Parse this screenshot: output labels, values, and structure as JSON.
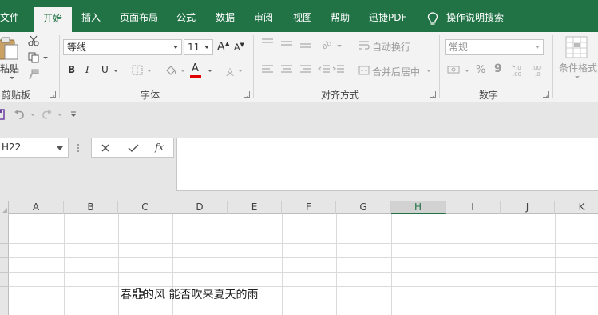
{
  "tabs": [
    {
      "label": "文件",
      "active": false
    },
    {
      "label": "开始",
      "active": true
    },
    {
      "label": "插入",
      "active": false
    },
    {
      "label": "页面布局",
      "active": false
    },
    {
      "label": "公式",
      "active": false
    },
    {
      "label": "数据",
      "active": false
    },
    {
      "label": "审阅",
      "active": false
    },
    {
      "label": "视图",
      "active": false
    },
    {
      "label": "帮助",
      "active": false
    },
    {
      "label": "迅捷PDF",
      "active": false
    }
  ],
  "tell_me": "操作说明搜索",
  "clipboard": {
    "paste_label": "粘贴",
    "group_label": "剪贴板"
  },
  "font": {
    "font_name": "等线",
    "font_size": "11",
    "bold": "B",
    "italic": "I",
    "underline": "U",
    "grow": "A",
    "shrink": "A",
    "font_color_letter": "A",
    "phonetic": "文",
    "group_label": "字体"
  },
  "alignment": {
    "wrap_text": "自动换行",
    "merge_center": "合并后居中",
    "group_label": "对齐方式"
  },
  "number": {
    "format": "常规",
    "percent": "%",
    "comma": "9",
    "group_label": "数字"
  },
  "styles": {
    "conditional_format": "条件格式"
  },
  "namebox": {
    "value": "H22"
  },
  "formula_bar": {
    "fx": "fx",
    "value": ""
  },
  "columns": [
    "A",
    "B",
    "C",
    "D",
    "E",
    "F",
    "G",
    "H",
    "I",
    "J",
    "K"
  ],
  "selected_column": "H",
  "cells": {
    "C_text": "春风的风 能否吹来夏天的雨"
  },
  "colors": {
    "accent": "#217346",
    "ribbon_bg": "#f3f3f3",
    "bar_bg": "#e6e6e6",
    "font_color_bar": "#e00000"
  }
}
